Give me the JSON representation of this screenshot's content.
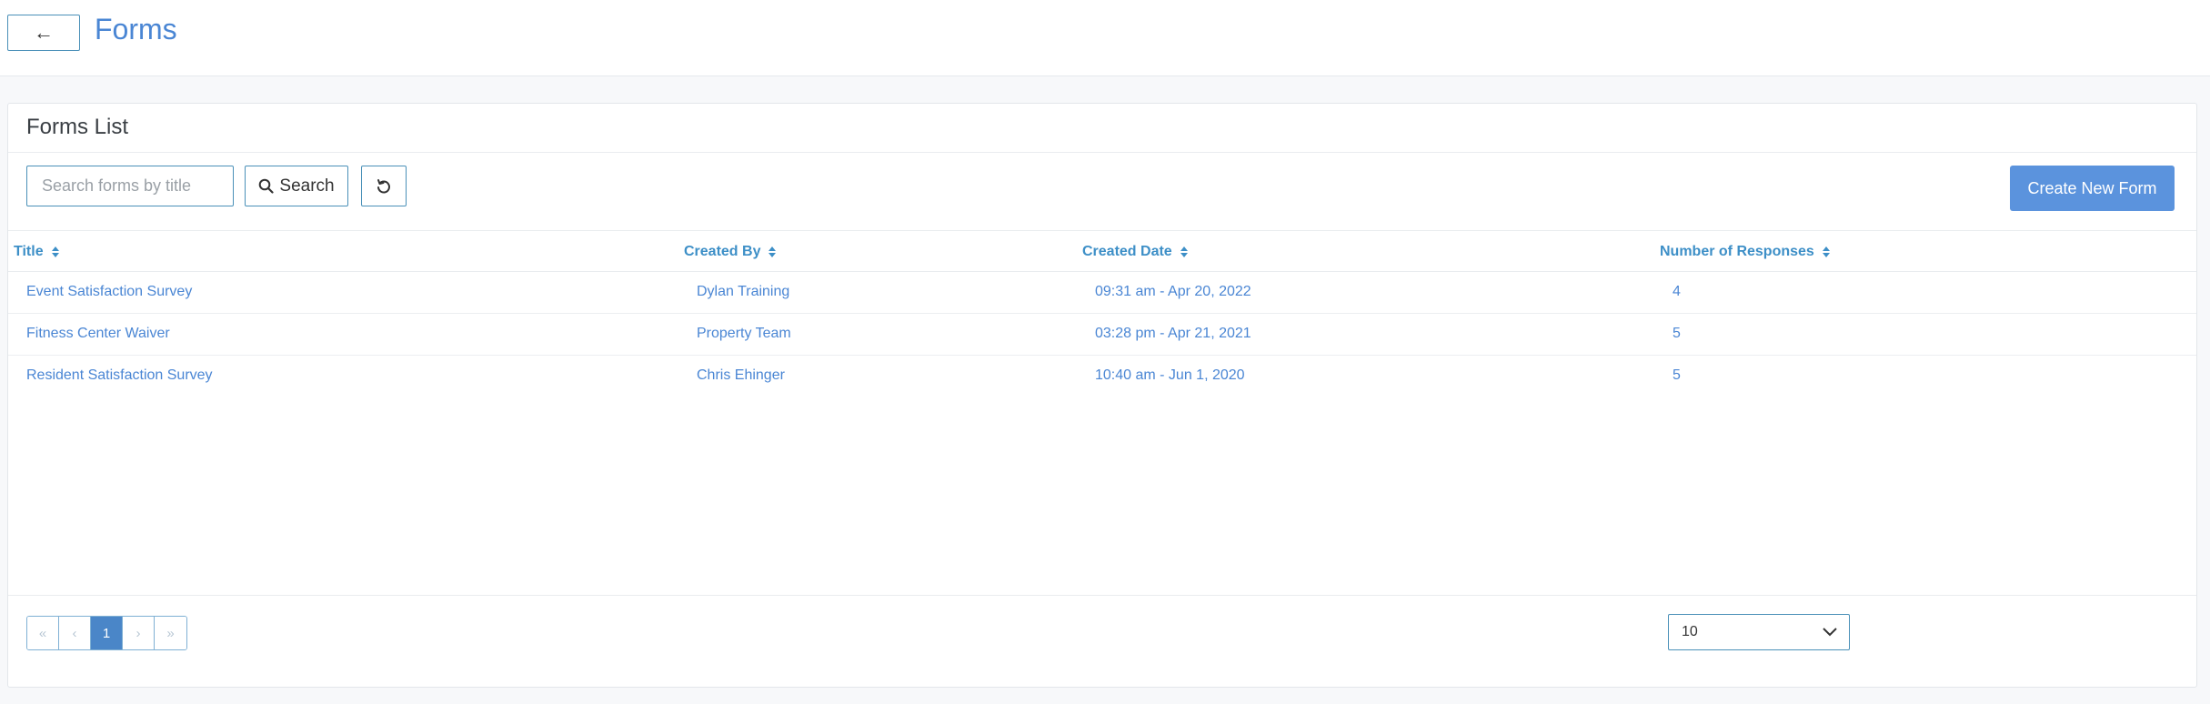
{
  "header": {
    "back_label": "←",
    "title": "Forms"
  },
  "card": {
    "title": "Forms List"
  },
  "toolbar": {
    "search_placeholder": "Search forms by title",
    "search_label": "Search",
    "create_label": "Create New Form"
  },
  "table": {
    "columns": [
      "Title",
      "Created By",
      "Created Date",
      "Number of Responses"
    ],
    "rows": [
      {
        "title": "Event Satisfaction Survey",
        "created_by": "Dylan Training",
        "created_date": "09:31 am - Apr 20, 2022",
        "responses": "4"
      },
      {
        "title": "Fitness Center Waiver",
        "created_by": "Property Team",
        "created_date": "03:28 pm - Apr 21, 2021",
        "responses": "5"
      },
      {
        "title": "Resident Satisfaction Survey",
        "created_by": "Chris Ehinger",
        "created_date": "10:40 am - Jun 1, 2020",
        "responses": "5"
      }
    ]
  },
  "pagination": {
    "first": "«",
    "prev": "‹",
    "current": "1",
    "next": "›",
    "last": "»",
    "page_size": "10"
  },
  "colors": {
    "accent": "#4a86d4",
    "primary_button": "#5b93dd",
    "header_link": "#3d8fc7"
  }
}
